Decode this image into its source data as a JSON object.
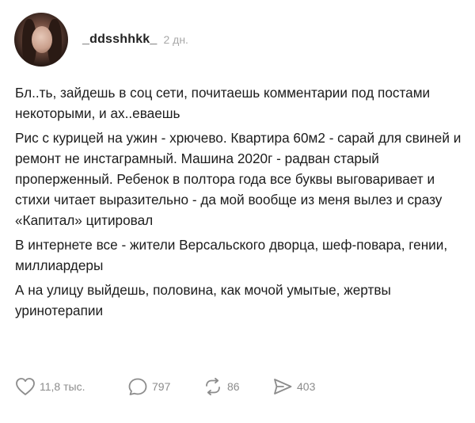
{
  "post": {
    "username": "_ddsshhkk_",
    "time": "2 дн.",
    "paragraphs": [
      "Бл..ть, зайдешь в соц сети, почитаешь комментарии под постами некоторыми, и ах..еваешь",
      "Рис с курицей на ужин - хрючево. Квартира 60м2 - сарай для свиней и ремонт не инстаграмный. Машина 2020г - радван старый проперженный. Ребенок в полтора года все буквы выговаривает и стихи читает выразительно - да мой вообще из меня вылез и сразу «Капитал» цитировал",
      "В интернете все - жители Версальского дворца, шеф-повара, гении, миллиардеры",
      "А на улицу выйдешь, половина, как мочой умытые, жертвы уринотерапии"
    ],
    "likes": "11,8 тыс.",
    "comments": "797",
    "reposts": "86",
    "shares": "403"
  },
  "icons": {
    "like": "heart-icon",
    "comment": "comment-bubble-icon",
    "repost": "repost-icon",
    "share": "send-icon"
  },
  "colors": {
    "text": "#1c1c1c",
    "muted": "#8c8c8c",
    "timestamp": "#a8a8a8"
  }
}
